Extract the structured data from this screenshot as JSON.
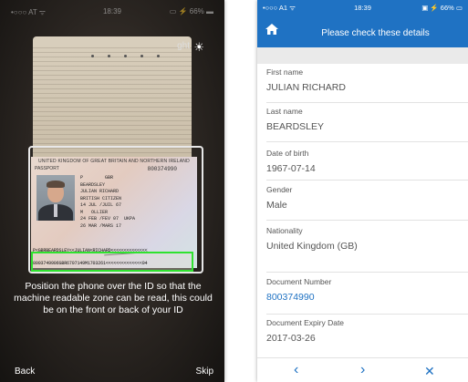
{
  "scan_screen": {
    "status": {
      "carrier": "•○○○ AT ᯤ",
      "time": "18:39",
      "battery": "▭ ⚡ 66% ▬"
    },
    "torch_label": "ght",
    "document": {
      "header": "UNITED KINGDOM OF GREAT BRITAIN AND NORTHERN IRELAND",
      "type_label": "PASSPORT",
      "type": "P",
      "country": "GBR",
      "number": "800374990",
      "surname": "BEARDSLEY",
      "given_names": "JULIAN RICHARD",
      "nationality": "BRITISH CITIZEN",
      "dob": "14 JUL /JUIL 67",
      "sex": "M",
      "place_of_birth": "OLLIER",
      "issue_date": "24 FEB /FEV 07",
      "expiry_date": "26 MAR /MARS 17",
      "authority": "UKPA",
      "mrz_line1": "P<GBRBEARDSLEY<<JULIAN<RICHARD<<<<<<<<<<<<<<",
      "mrz_line2": "8003749906GBR6707149M1703261<<<<<<<<<<<<<<04"
    },
    "instructions": "Position the phone over the ID so that the machine readable zone can be read, this could be on the front or back of your ID",
    "back_label": "Back",
    "skip_label": "Skip"
  },
  "details_screen": {
    "status": {
      "carrier": "•○○○ A1 ᯤ",
      "time": "18:39",
      "battery": "▣ ⚡ 66% ▭"
    },
    "title": "Please check these details",
    "fields": [
      {
        "label": "First name",
        "value": "JULIAN RICHARD"
      },
      {
        "label": "Last name",
        "value": "BEARDSLEY"
      },
      {
        "label": "Date of birth",
        "value": "1967-07-14"
      },
      {
        "label": "Gender",
        "value": "Male"
      },
      {
        "label": "Nationality",
        "value": "United Kingdom (GB)"
      },
      {
        "label": "Document Number",
        "value": "800374990"
      },
      {
        "label": "Document Expiry Date",
        "value": "2017-03-26"
      }
    ],
    "nav": {
      "prev": "‹",
      "next": "›",
      "close": "✕"
    },
    "accent_color": "#1f72c3"
  }
}
